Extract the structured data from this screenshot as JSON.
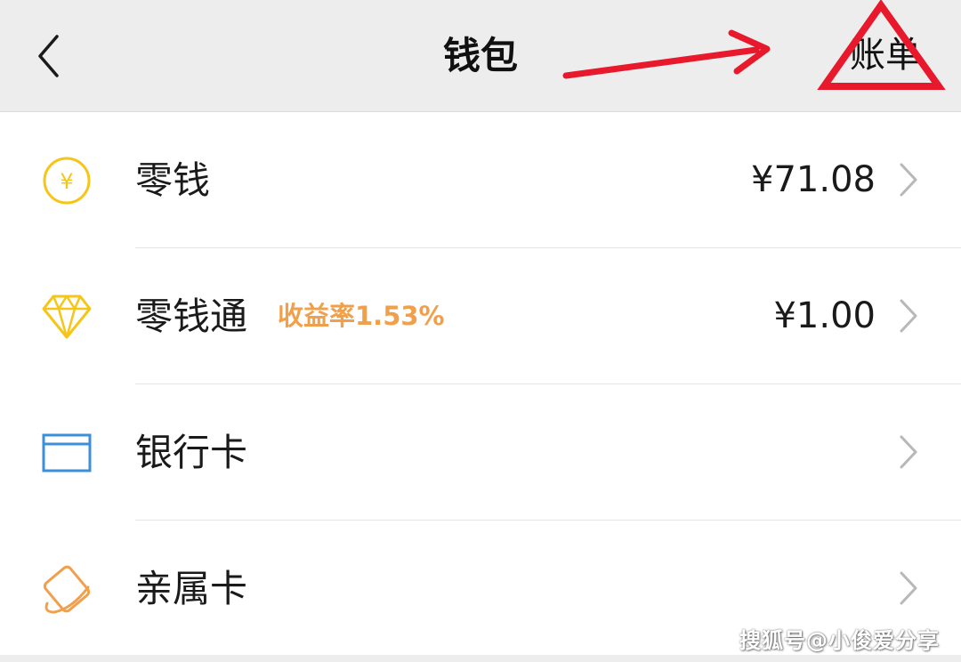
{
  "header": {
    "title": "钱包",
    "bill_label": "账单"
  },
  "list": {
    "items": [
      {
        "label": "零钱",
        "value": "¥71.08",
        "icon": "coin-yen-icon"
      },
      {
        "label": "零钱通",
        "tag": "收益率1.53%",
        "value": "¥1.00",
        "icon": "diamond-icon"
      },
      {
        "label": "银行卡",
        "value": "",
        "icon": "bank-card-icon"
      },
      {
        "label": "亲属卡",
        "value": "",
        "icon": "family-card-icon"
      }
    ]
  },
  "watermark": "搜狐号@小俊爱分享",
  "colors": {
    "header_bg": "#ededed",
    "coin": "#f5c518",
    "diamond": "#f5c518",
    "bank_card": "#3d8fd9",
    "family_card": "#f0a04b",
    "tag": "#f0a04b",
    "annotation_red": "#e8192c"
  }
}
